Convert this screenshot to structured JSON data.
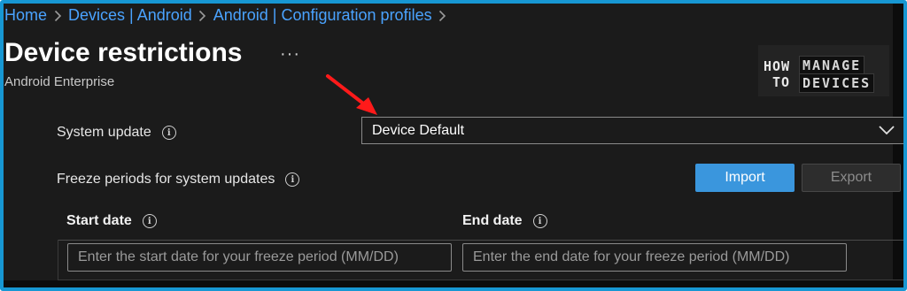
{
  "breadcrumb": {
    "items": [
      "Home",
      "Devices | Android",
      "Android | Configuration profiles"
    ]
  },
  "header": {
    "title": "Device restrictions",
    "more_label": "···",
    "subtitle": "Android Enterprise"
  },
  "logo": {
    "how": "HOW",
    "to": "TO",
    "manage": "MANAGE",
    "devices": "DEVICES"
  },
  "system_update": {
    "label": "System update",
    "selected": "Device Default"
  },
  "freeze_periods": {
    "label": "Freeze periods for system updates",
    "import_label": "Import",
    "export_label": "Export",
    "columns": [
      "Start date",
      "End date"
    ],
    "start_placeholder": "Enter the start date for your freeze period (MM/DD)",
    "end_placeholder": "Enter the end date for your freeze period (MM/DD)"
  },
  "colors": {
    "accent": "#1797d3",
    "link": "#4aa3ff",
    "primary_button": "#3a96dd",
    "annotation_arrow": "#ff1a1a",
    "background": "#1b1b1b"
  },
  "icons": {
    "breadcrumb_separator": "chevron-right-icon",
    "info": "info-icon",
    "dropdown": "chevron-down-icon",
    "annotation": "red-arrow-icon"
  }
}
